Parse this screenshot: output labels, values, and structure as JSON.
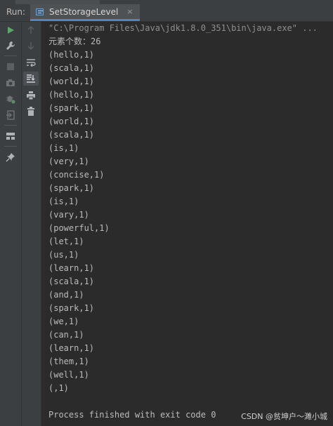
{
  "header": {
    "run_label": "Run:",
    "tab_label": "SetStorageLevel",
    "tab_close": "×"
  },
  "console": {
    "command": "\"C:\\Program Files\\Java\\jdk1.8.0_351\\bin\\java.exe\" ...",
    "lines": [
      "元素个数：26",
      "(hello,1)",
      "(scala,1)",
      "(world,1)",
      "(hello,1)",
      "(spark,1)",
      "(world,1)",
      "(scala,1)",
      "(is,1)",
      "(very,1)",
      "(concise,1)",
      "(spark,1)",
      "(is,1)",
      "(vary,1)",
      "(powerful,1)",
      "(let,1)",
      "(us,1)",
      "(learn,1)",
      "(scala,1)",
      "(and,1)",
      "(spark,1)",
      "(we,1)",
      "(can,1)",
      "(learn,1)",
      "(them,1)",
      "(well,1)",
      "(,1)"
    ],
    "exit_message": "Process finished with exit code 0"
  },
  "watermark": "CSDN @贫坤户～濉小城",
  "colors": {
    "background": "#2b2b2b",
    "panel": "#3c3f41",
    "accent": "#4a88c7",
    "run_green": "#59a869",
    "text": "#bbbbbb"
  },
  "icons": {
    "left_toolbar": [
      "run-icon",
      "wrench-icon",
      "stop-icon",
      "camera-icon",
      "bug-settings-icon",
      "exit-icon",
      "layout-icon",
      "pin-icon"
    ],
    "right_toolbar": [
      "arrow-up-icon",
      "arrow-down-icon",
      "soft-wrap-icon",
      "scroll-to-end-icon",
      "print-icon",
      "trash-icon"
    ]
  }
}
